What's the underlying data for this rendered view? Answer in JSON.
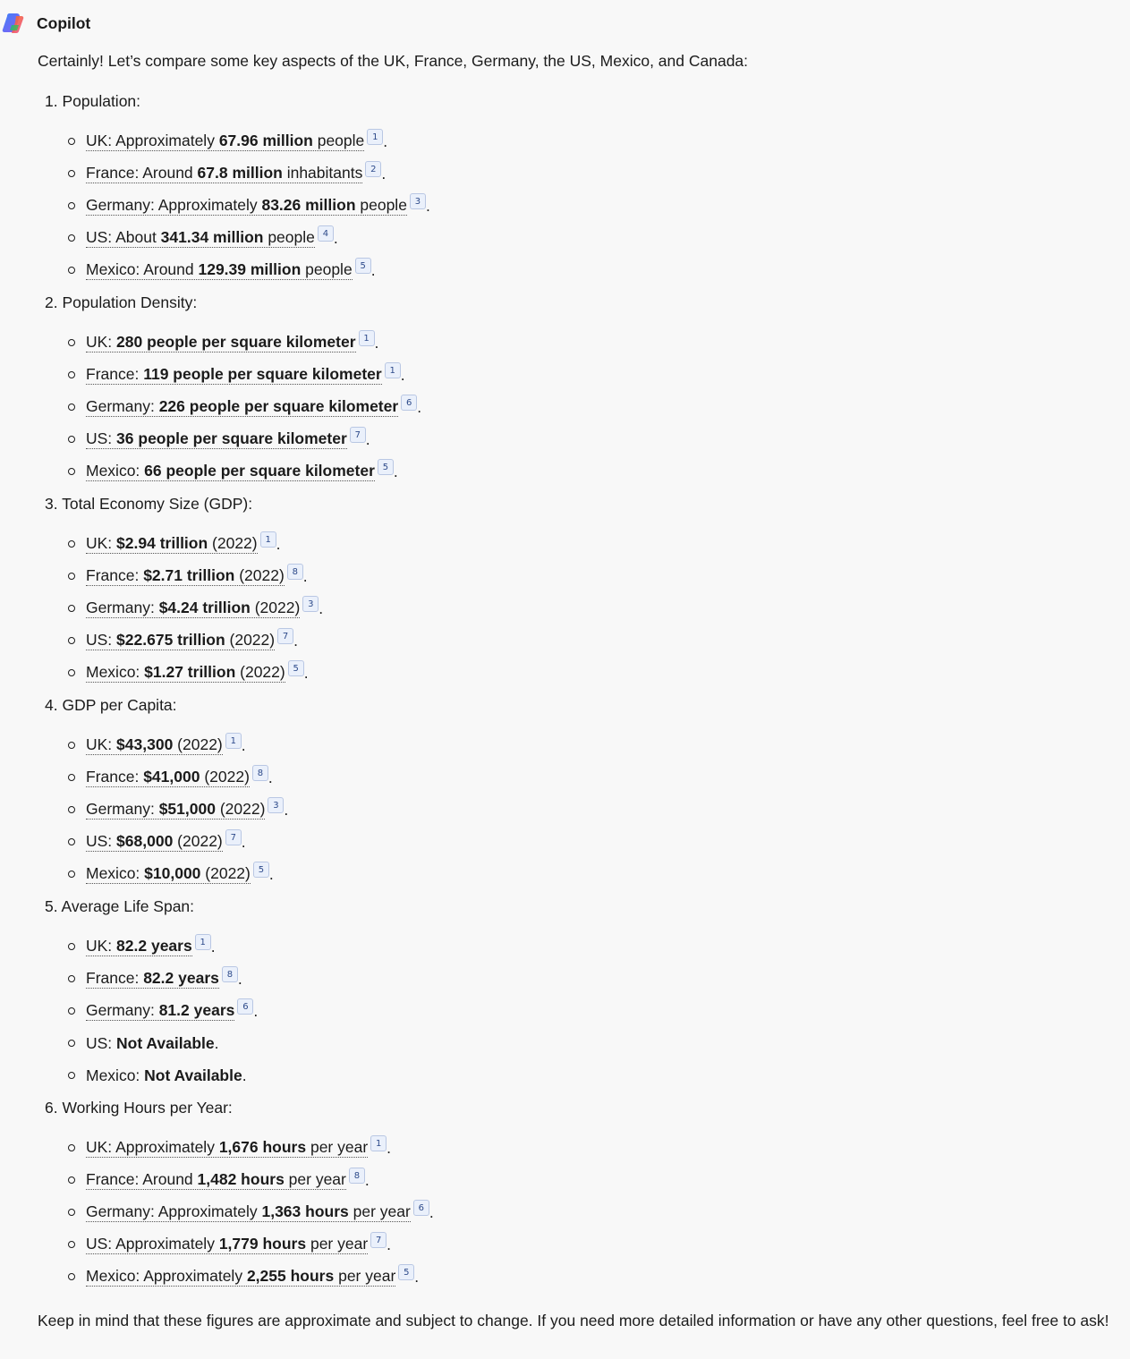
{
  "app_name": "Copilot",
  "intro": "Certainly! Let’s compare some key aspects of the UK, France, Germany, the US, Mexico, and Canada:",
  "sections": [
    {
      "title": "1. Population:",
      "items": [
        {
          "label": "UK: Approximately ",
          "value": "67.96 million",
          "suffix": " people",
          "cite": "1",
          "cited": true
        },
        {
          "label": "France: Around ",
          "value": "67.8 million",
          "suffix": " inhabitants",
          "cite": "2",
          "cited": true
        },
        {
          "label": "Germany: Approximately ",
          "value": "83.26 million",
          "suffix": " people",
          "cite": "3",
          "cited": true
        },
        {
          "label": "US: About ",
          "value": "341.34 million",
          "suffix": " people",
          "cite": "4",
          "cited": true
        },
        {
          "label": "Mexico: Around ",
          "value": "129.39 million",
          "suffix": " people",
          "cite": "5",
          "cited": true
        }
      ]
    },
    {
      "title": "2. Population Density:",
      "items": [
        {
          "label": "UK: ",
          "value": "280 people per square kilometer",
          "suffix": "",
          "cite": "1",
          "cited": true
        },
        {
          "label": "France: ",
          "value": "119 people per square kilometer",
          "suffix": "",
          "cite": "1",
          "cited": true
        },
        {
          "label": "Germany: ",
          "value": "226 people per square kilometer",
          "suffix": "",
          "cite": "6",
          "cited": true
        },
        {
          "label": "US: ",
          "value": "36 people per square kilometer",
          "suffix": "",
          "cite": "7",
          "cited": true
        },
        {
          "label": "Mexico: ",
          "value": "66 people per square kilometer",
          "suffix": "",
          "cite": "5",
          "cited": true
        }
      ]
    },
    {
      "title": "3. Total Economy Size (GDP):",
      "items": [
        {
          "label": "UK: ",
          "value": "$2.94 trillion",
          "suffix": " (2022) ",
          "cite": "1",
          "cited": true
        },
        {
          "label": "France: ",
          "value": "$2.71 trillion",
          "suffix": " (2022) ",
          "cite": "8",
          "cited": true
        },
        {
          "label": "Germany: ",
          "value": "$4.24 trillion",
          "suffix": " (2022) ",
          "cite": "3",
          "cited": true
        },
        {
          "label": "US: ",
          "value": "$22.675 trillion",
          "suffix": " (2022) ",
          "cite": "7",
          "cited": true
        },
        {
          "label": "Mexico: ",
          "value": "$1.27 trillion",
          "suffix": " (2022) ",
          "cite": "5",
          "cited": true
        }
      ]
    },
    {
      "title": "4. GDP per Capita:",
      "items": [
        {
          "label": "UK: ",
          "value": "$43,300",
          "suffix": " (2022) ",
          "cite": "1",
          "cited": true
        },
        {
          "label": "France: ",
          "value": "$41,000",
          "suffix": " (2022) ",
          "cite": "8",
          "cited": true
        },
        {
          "label": "Germany: ",
          "value": "$51,000",
          "suffix": " (2022) ",
          "cite": "3",
          "cited": true
        },
        {
          "label": "US: ",
          "value": "$68,000",
          "suffix": " (2022) ",
          "cite": "7",
          "cited": true
        },
        {
          "label": "Mexico: ",
          "value": "$10,000",
          "suffix": " (2022) ",
          "cite": "5",
          "cited": true
        }
      ]
    },
    {
      "title": "5. Average Life Span:",
      "items": [
        {
          "label": "UK: ",
          "value": "82.2 years",
          "suffix": " ",
          "cite": "1",
          "cited": true
        },
        {
          "label": "France: ",
          "value": "82.2 years",
          "suffix": " ",
          "cite": "8",
          "cited": true
        },
        {
          "label": "Germany: ",
          "value": "81.2 years",
          "suffix": " ",
          "cite": "6",
          "cited": true
        },
        {
          "label": "US: ",
          "value": "Not Available",
          "suffix": "",
          "cite": "",
          "cited": false
        },
        {
          "label": "Mexico: ",
          "value": "Not Available",
          "suffix": "",
          "cite": "",
          "cited": false
        }
      ]
    },
    {
      "title": "6. Working Hours per Year:",
      "items": [
        {
          "label": "UK: Approximately ",
          "value": "1,676 hours",
          "suffix": " per year ",
          "cite": "1",
          "cited": true
        },
        {
          "label": "France: Around ",
          "value": "1,482 hours",
          "suffix": " per year ",
          "cite": "8",
          "cited": true
        },
        {
          "label": "Germany: Approximately ",
          "value": "1,363 hours",
          "suffix": " per year ",
          "cite": "6",
          "cited": true
        },
        {
          "label": "US: Approximately ",
          "value": "1,779 hours",
          "suffix": " per year ",
          "cite": "7",
          "cited": true
        },
        {
          "label": "Mexico: Approximately ",
          "value": "2,255 hours",
          "suffix": " per year ",
          "cite": "5",
          "cited": true
        }
      ]
    }
  ],
  "outro": "Keep in mind that these figures are approximate and subject to change. If you need more detailed information or have any other questions, feel free to ask!",
  "colors": {
    "background": "#f8f8f8",
    "text": "#1b1b1b",
    "citation_badge": "#eaf0fb"
  }
}
